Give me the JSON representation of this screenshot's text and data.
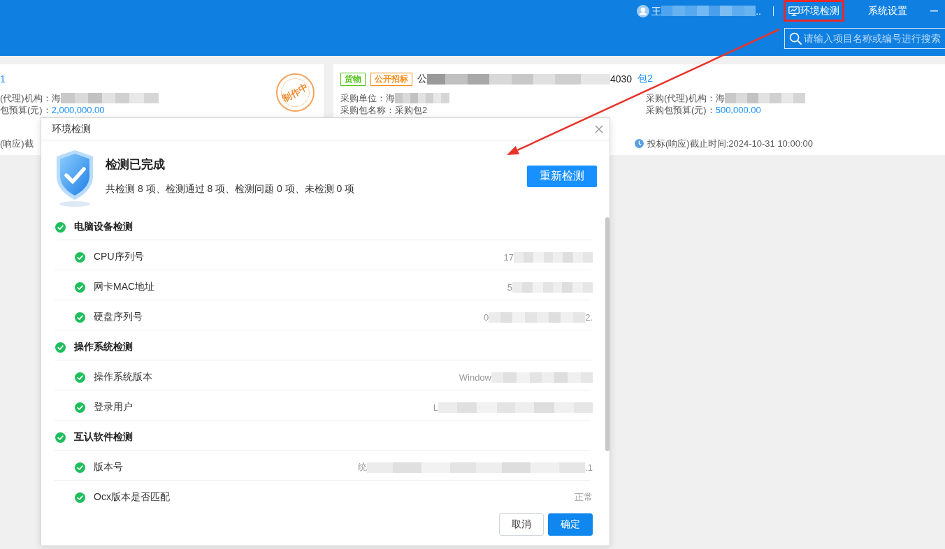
{
  "topbar": {
    "user": {
      "kind": "redacted",
      "head": "王",
      "tail": ".."
    },
    "nav": [
      {
        "label": "环境检测",
        "icon": true,
        "highlighted": true
      },
      {
        "label": "系统设置",
        "icon": false,
        "highlighted": false
      }
    ],
    "search": {
      "placeholder": "请输入项目名称或编号进行搜索"
    }
  },
  "cards": [
    {
      "package_link": "1",
      "stamp": "制作中",
      "fields_left": [
        {
          "label": "(代理)机构：",
          "kind": "text",
          "value": {
            "kind": "redacted",
            "head": "海"
          }
        },
        {
          "label": "包预算(元)：",
          "kind": "amount",
          "value": "2,000,000.00"
        }
      ],
      "deadline": {
        "text": "(响应)截",
        "icon": false
      }
    },
    {
      "tags": [
        {
          "label": "货物",
          "color": "#52c41a"
        },
        {
          "label": "公开招标",
          "color": "#fa8c16"
        }
      ],
      "title": {
        "kind": "redacted",
        "head": "公",
        "tail": "4030"
      },
      "package_link": "包2",
      "fields_left": [
        {
          "label": "采购单位：",
          "kind": "text",
          "value": {
            "kind": "redacted",
            "head": "海"
          }
        },
        {
          "label": "采购包名称：",
          "kind": "text",
          "value": "采购包2"
        }
      ],
      "fields_right": [
        {
          "label": "采购(代理)机构：",
          "kind": "text",
          "value": {
            "kind": "redacted",
            "head": "海"
          }
        },
        {
          "label": "采购包预算(元)：",
          "kind": "amount",
          "value": "500,000.00"
        }
      ],
      "deadline": {
        "text": "投标(响应)截止时间:2024-10-31 10:00:00",
        "icon": true
      }
    }
  ],
  "dialog": {
    "title": "环境检测",
    "status_title": "检测已完成",
    "summary": "共检测 8 项、检测通过 8 项、检测问题 0 项、未检测 0 项",
    "recheck_button": "重新检测",
    "groups": [
      {
        "title": "电脑设备检测",
        "passed": true,
        "children": [
          {
            "label": "CPU序列号",
            "passed": true,
            "value": {
              "kind": "redacted",
              "head": "17"
            }
          },
          {
            "label": "网卡MAC地址",
            "passed": true,
            "value": {
              "kind": "redacted",
              "head": "5"
            }
          },
          {
            "label": "硬盘序列号",
            "passed": true,
            "value": {
              "kind": "redacted",
              "head": "0",
              "tail": "2."
            }
          }
        ]
      },
      {
        "title": "操作系统检测",
        "passed": true,
        "children": [
          {
            "label": "操作系统版本",
            "passed": true,
            "value": {
              "kind": "redacted",
              "head": "Window"
            }
          },
          {
            "label": "登录用户",
            "passed": true,
            "value": {
              "kind": "redacted",
              "head": "L"
            }
          }
        ]
      },
      {
        "title": "互认软件检测",
        "passed": true,
        "children": [
          {
            "label": "版本号",
            "passed": true,
            "value": {
              "kind": "redacted",
              "head": "统",
              "tail": ".1"
            }
          },
          {
            "label": "Ocx版本是否匹配",
            "passed": true,
            "value": "正常"
          }
        ]
      }
    ],
    "buttons": [
      {
        "label": "取消",
        "primary": false
      },
      {
        "label": "确定",
        "primary": true
      }
    ]
  }
}
